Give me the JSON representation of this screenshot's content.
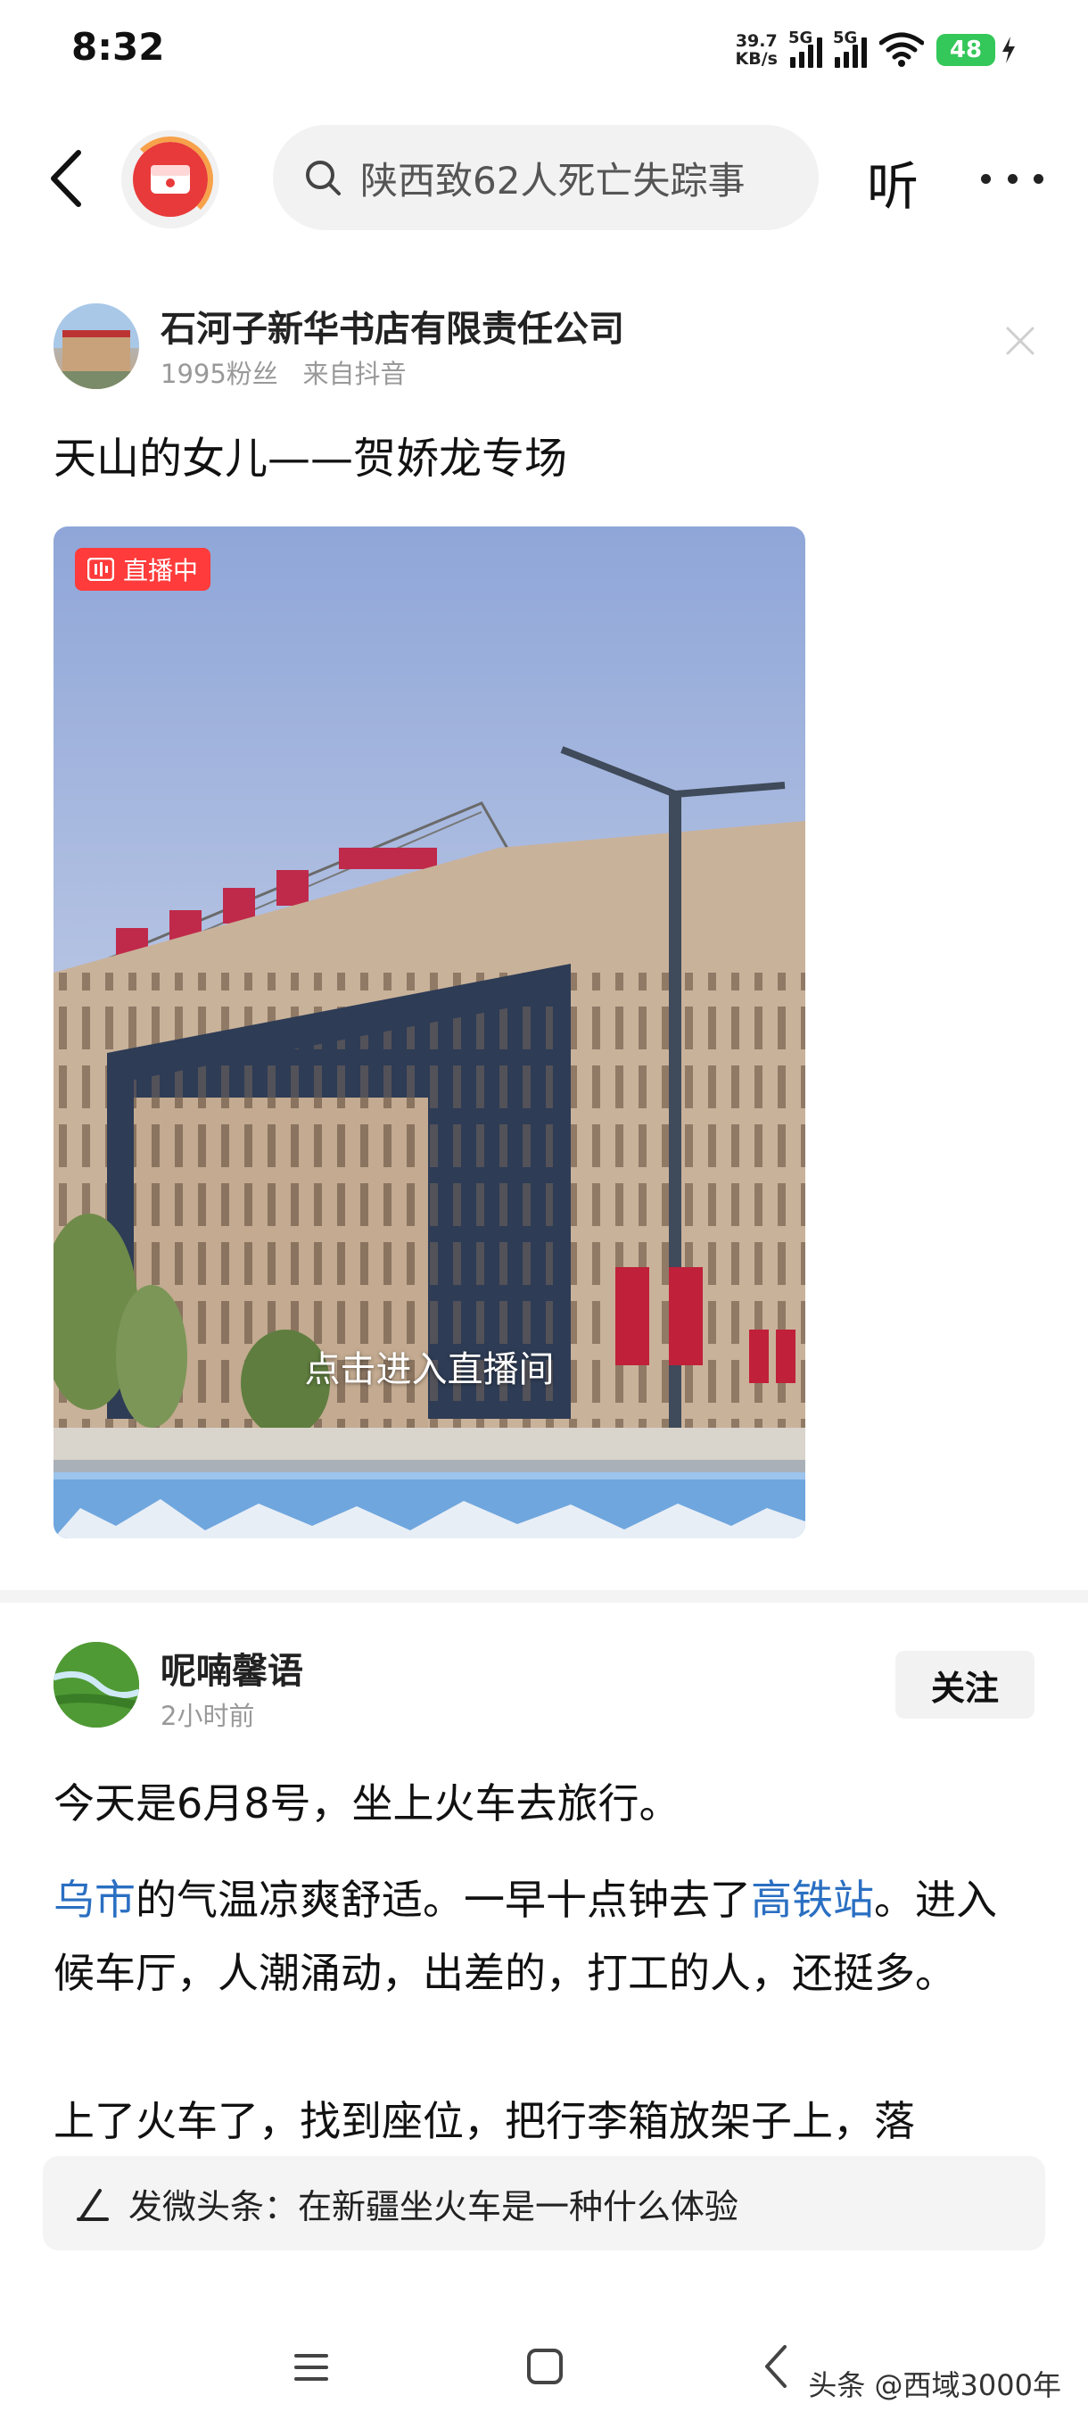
{
  "status_bar": {
    "time": "8:32",
    "net_speed_value": "39.7",
    "net_speed_unit": "KB/s",
    "sim1_label": "5G",
    "sim2_label": "5G",
    "battery": "48"
  },
  "top_nav": {
    "search_placeholder": "陕西致62人死亡失踪事",
    "listen_label": "听"
  },
  "post1": {
    "author": "石河子新华书店有限责任公司",
    "followers": "1995粉丝",
    "source": "来自抖音",
    "title": "天山的女儿——贺娇龙专场",
    "live_badge": "直播中",
    "enter_live": "点击进入直播间"
  },
  "post2": {
    "author": "呢喃馨语",
    "time": "2小时前",
    "follow_label": "关注",
    "para1": "今天是6月8号，坐上火车去旅行。",
    "para2_link1": "乌市",
    "para2_text1": "的气温凉爽舒适。一早十点钟去了",
    "para2_link2": "高铁站",
    "para2_text2": "。进入候车厅，人潮涌动，出差的，打工的人，还挺多。",
    "para3": "上了火车了，找到座位，把行李箱放架子上，落"
  },
  "compose": {
    "text": "发微头条：在新疆坐火车是一种什么体验"
  },
  "watermark": "头条 @西域3000年",
  "colors": {
    "accent_red": "#ff3b3b",
    "link_blue": "#2a6fc2",
    "battery_green": "#34c759"
  }
}
